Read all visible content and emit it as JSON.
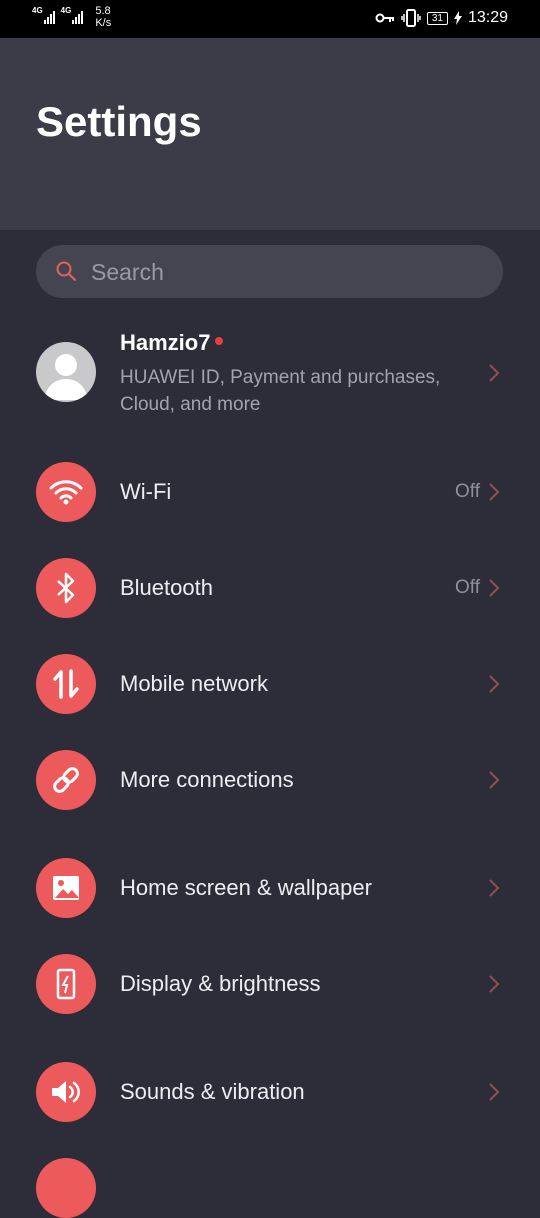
{
  "status_bar": {
    "network_1": "4G",
    "network_2": "4G",
    "speed_value": "5.8",
    "speed_unit": "K/s",
    "battery": "31",
    "time": "13:29"
  },
  "header": {
    "title": "Settings"
  },
  "search": {
    "placeholder": "Search"
  },
  "account": {
    "name": "Hamzio7",
    "description": "HUAWEI ID, Payment and purchases, Cloud, and more"
  },
  "items": [
    {
      "label": "Wi-Fi",
      "value": "Off",
      "icon": "wifi-icon"
    },
    {
      "label": "Bluetooth",
      "value": "Off",
      "icon": "bluetooth-icon"
    },
    {
      "label": "Mobile network",
      "value": "",
      "icon": "mobile-data-icon"
    },
    {
      "label": "More connections",
      "value": "",
      "icon": "link-icon"
    },
    {
      "label": "Home screen & wallpaper",
      "value": "",
      "icon": "image-icon"
    },
    {
      "label": "Display & brightness",
      "value": "",
      "icon": "display-icon"
    },
    {
      "label": "Sounds & vibration",
      "value": "",
      "icon": "speaker-icon"
    }
  ],
  "colors": {
    "accent": "#ec5a5c",
    "background": "#2d2d3a",
    "header": "#3c3c49",
    "notification_dot": "#e8403a"
  }
}
